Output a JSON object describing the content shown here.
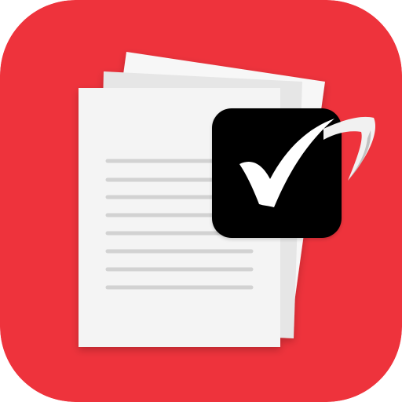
{
  "app_icon": {
    "name": "document-checklist-app-icon",
    "colors": {
      "background": "#EE333C",
      "paper_front": "#F4F4F4",
      "paper_back_1": "#E6E6E6",
      "paper_back_2": "#F7F7F7",
      "text_lines": "#D2D2D2",
      "checkbox": "#050505",
      "checkmark": "#FFFFFF",
      "check_swoosh": "#F1F1F1",
      "check_swoosh_shadow": "#B9B9B9"
    },
    "document": {
      "line_count": 8
    }
  }
}
